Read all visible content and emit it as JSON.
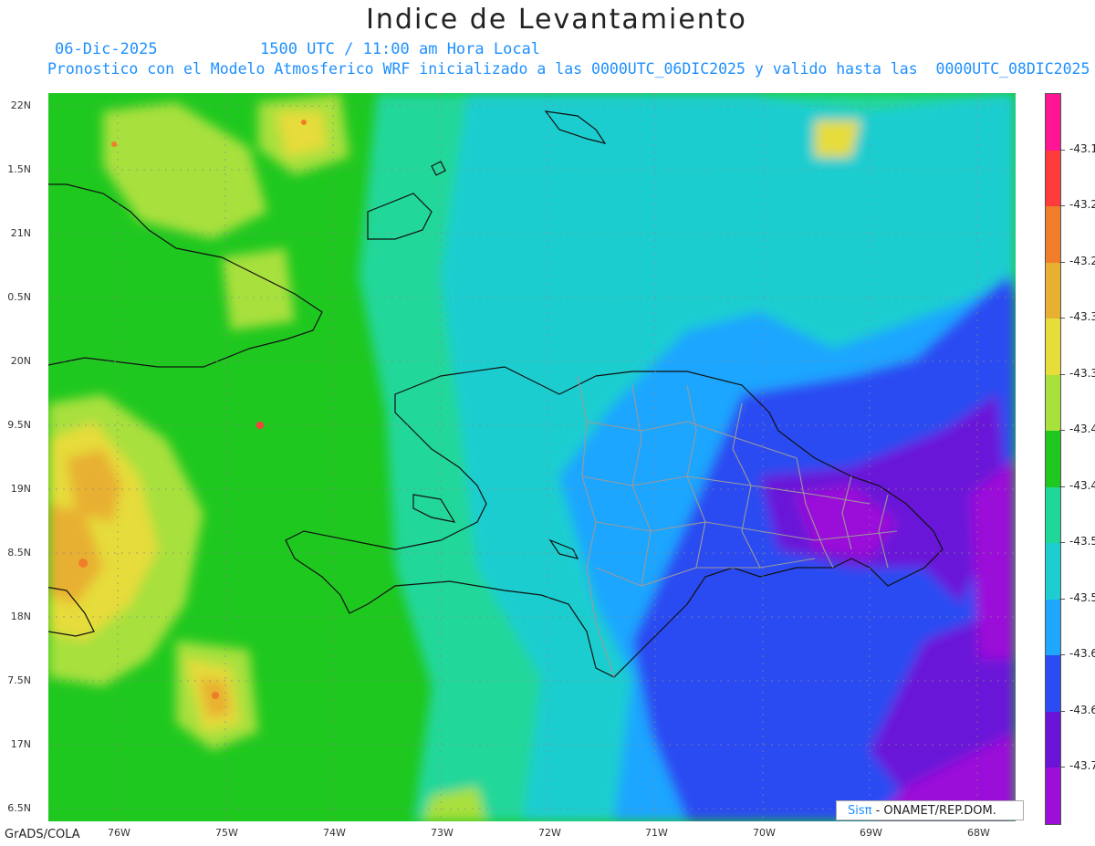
{
  "title": "Indice de Levantamiento",
  "date": "06-Dic-2025",
  "utc_time": "1500 UTC / 11:00 am Hora Local",
  "description": "Pronostico con el Modelo Atmosferico WRF inicializado a las 0000UTC_06DIC2025 y valido hasta las  0000UTC_08DIC2025",
  "latitude_labels": [
    "22N",
    "1.5N",
    "21N",
    "0.5N",
    "20N",
    "9.5N",
    "19N",
    "8.5N",
    "18N",
    "7.5N",
    "17N",
    "6.5N"
  ],
  "longitude_labels": [
    "76W",
    "75W",
    "74W",
    "73W",
    "72W",
    "71W",
    "70W",
    "69W",
    "68W"
  ],
  "colorbar": {
    "labels": [
      "-43.1",
      "-43.2",
      "-43.2",
      "-43.3",
      "-43.3",
      "-43.4",
      "-43.4",
      "-43.5",
      "-43.5",
      "-43.6",
      "-43.6",
      "-43.7"
    ],
    "colors": [
      "#ff1493",
      "#ff3b3b",
      "#f07d2a",
      "#e8b031",
      "#e6dc3a",
      "#a8e03c",
      "#1fc81f",
      "#20d79a",
      "#1ecdd0",
      "#1fa6ff",
      "#2b4cf2",
      "#6a14d8",
      "#9b0fd8"
    ]
  },
  "footer_left": "GrADS/COLA",
  "credit": {
    "brand": "Sisπ",
    "org": " - ONAMET/REP.DOM."
  }
}
